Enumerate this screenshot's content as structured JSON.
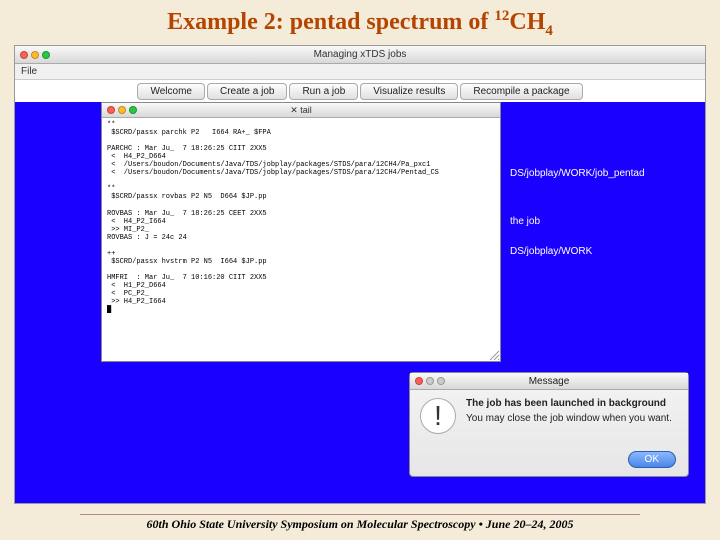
{
  "title_prefix": "Example 2: pentad spectrum of ",
  "title_sup": "12",
  "title_mid": "CH",
  "title_sub": "4",
  "outer_window": {
    "title": "Managing xTDS jobs",
    "menu_file": "File"
  },
  "tabs": [
    "Welcome",
    "Create a job",
    "Run a job",
    "Visualize results",
    "Recompile a package"
  ],
  "terminal": {
    "title": "tail",
    "body": "**\n $SCRD/passx parchk P2   I664 RA+_ $FPA\n\nPARCHC : Mar Ju_  7 18:26:25 CIIT 2XX5\n <  H4_P2_D664\n <  /Users/boudon/Documents/Java/TDS/jobplay/packages/STDS/para/12CH4/Pa_pxc1\n <  /Users/boudon/Documents/Java/TDS/jobplay/packages/STDS/para/12CH4/Pentad_CS\n\n**\n $SCRD/passx rovbas P2 N5  D664 $JP.pp\n\nROVBAS : Mar Ju_  7 18:26:25 CEET 2XX5\n <  H4_P2_I664\n >> MI_P2_\nROVBAS : J = 24c 24\n\n++\n $SCRD/passx hvstrm P2 N5  I664 $JP.pp\n\nHMFRI  : Mar Ju_  7 10:16:20 CIIT 2XX5\n <  H1_P2_D664\n <  PC_P2_\n >> H4_P2_I664\n█"
  },
  "bg_labels": {
    "l1": "DS/jobplay/WORK/job_pentad",
    "l2": "the job",
    "l3": "DS/jobplay/WORK"
  },
  "message": {
    "title": "Message",
    "line1": "The job has been launched in background",
    "line2": "You may close the job window when you want.",
    "ok": "OK"
  },
  "footer": "60th Ohio State University Symposium on Molecular Spectroscopy • June 20–24, 2005"
}
